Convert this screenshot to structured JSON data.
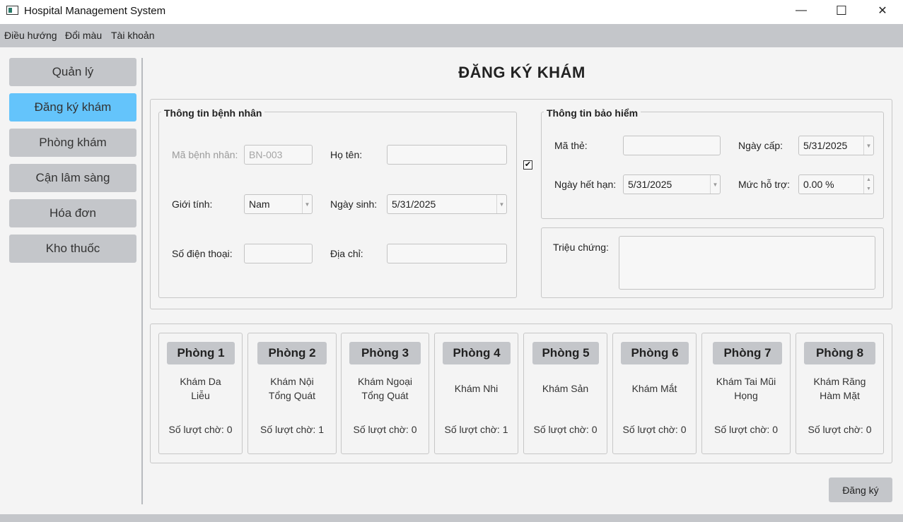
{
  "window": {
    "title": "Hospital Management System",
    "controls": [
      "—",
      "☐",
      "✕"
    ]
  },
  "menu": [
    "Điều hướng",
    "Đổi màu",
    "Tài khoản"
  ],
  "sidebar": {
    "items": [
      {
        "label": "Quản lý"
      },
      {
        "label": "Đăng ký khám",
        "active": true
      },
      {
        "label": "Phòng khám"
      },
      {
        "label": "Cận lâm sàng"
      },
      {
        "label": "Hóa đơn"
      },
      {
        "label": "Kho thuốc"
      }
    ]
  },
  "page": {
    "title": "ĐĂNG KÝ KHÁM"
  },
  "patient": {
    "legend": "Thông tin bệnh nhân",
    "id_label": "Mã bệnh nhân:",
    "id_value": "BN-003",
    "name_label": "Họ tên:",
    "name_value": "",
    "gender_label": "Giới tính:",
    "gender_value": "Nam",
    "dob_label": "Ngày sinh:",
    "dob_value": "5/31/2025",
    "phone_label": "Số điện thoại:",
    "phone_value": "",
    "address_label": "Địa chỉ:",
    "address_value": ""
  },
  "insurance": {
    "enabled_mark": "✔",
    "legend": "Thông tin bảo hiểm",
    "card_label": "Mã thẻ:",
    "card_value": "",
    "issue_label": "Ngày cấp:",
    "issue_value": "5/31/2025",
    "expiry_label": "Ngày hết hạn:",
    "expiry_value": "5/31/2025",
    "support_label": "Mức hỗ trợ:",
    "support_value": "0.00 %"
  },
  "symptoms": {
    "label": "Triệu chứng:",
    "value": ""
  },
  "rooms": [
    {
      "name": "Phòng 1",
      "desc_line1": "Khám Da",
      "desc_line2": "Liễu",
      "wait": "Số lượt chờ: 0"
    },
    {
      "name": "Phòng 2",
      "desc_line1": "Khám Nội",
      "desc_line2": "Tổng Quát",
      "wait": "Số lượt chờ: 1"
    },
    {
      "name": "Phòng 3",
      "desc_line1": "Khám Ngoại",
      "desc_line2": "Tổng Quát",
      "wait": "Số lượt chờ: 0"
    },
    {
      "name": "Phòng 4",
      "desc_line1": "Khám Nhi",
      "desc_line2": "",
      "wait": "Số lượt chờ: 1"
    },
    {
      "name": "Phòng 5",
      "desc_line1": "Khám Sản",
      "desc_line2": "",
      "wait": "Số lượt chờ: 0"
    },
    {
      "name": "Phòng 6",
      "desc_line1": "Khám Mắt",
      "desc_line2": "",
      "wait": "Số lượt chờ: 0"
    },
    {
      "name": "Phòng 7",
      "desc_line1": "Khám Tai Mũi",
      "desc_line2": "Họng",
      "wait": "Số lượt chờ: 0"
    },
    {
      "name": "Phòng 8",
      "desc_line1": "Khám Răng",
      "desc_line2": "Hàm Mặt",
      "wait": "Số lượt chờ: 0"
    }
  ],
  "actions": {
    "submit_label": "Đăng ký"
  },
  "colors": {
    "accent": "#64c4fb",
    "button": "#c4c6ca",
    "background": "#f4f4f4"
  }
}
